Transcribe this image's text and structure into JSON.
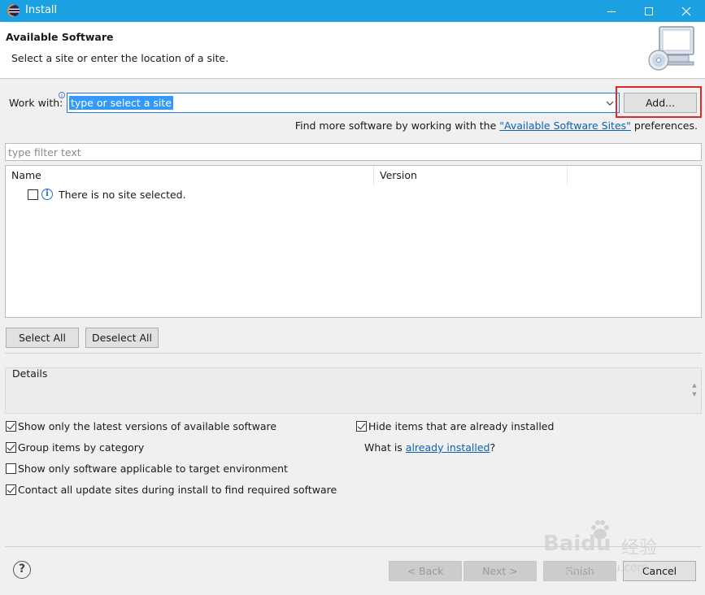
{
  "window": {
    "title": "Install"
  },
  "header": {
    "title": "Available Software",
    "subtitle": "Select a site or enter the location of a site."
  },
  "work_with": {
    "label": "Work with:",
    "value": "type or select a site",
    "add_button": "Add...",
    "prefs_text_before": "Find more software by working with the ",
    "prefs_link": "\"Available Software Sites\"",
    "prefs_text_after": " preferences."
  },
  "filter": {
    "placeholder": "type filter text"
  },
  "tree": {
    "columns": [
      "Name",
      "Version"
    ],
    "empty_message": "There is no site selected."
  },
  "selection_buttons": {
    "select_all": "Select All",
    "deselect_all": "Deselect All"
  },
  "details": {
    "label": "Details"
  },
  "options": {
    "show_latest": {
      "label": "Show only the latest versions of available software",
      "checked": true
    },
    "group_by_category": {
      "label": "Group items by category",
      "checked": true
    },
    "applicable_only": {
      "label": "Show only software applicable to target environment",
      "checked": false
    },
    "contact_sites": {
      "label": "Contact all update sites during install to find required software",
      "checked": true
    },
    "hide_installed": {
      "label": "Hide items that are already installed",
      "checked": true
    },
    "what_is_prefix": "What is ",
    "what_is_link": "already installed",
    "what_is_suffix": "?"
  },
  "footer": {
    "back": "< Back",
    "next": "Next >",
    "finish": "Finish",
    "cancel": "Cancel"
  },
  "watermark": {
    "brand": "Baidu",
    "cn": "经验",
    "url": "jingyan.baidu.com"
  },
  "colors": {
    "titlebar": "#1ba1e2",
    "link": "#0b61b4",
    "highlight": "#e02828",
    "selection": "#3399ff"
  }
}
